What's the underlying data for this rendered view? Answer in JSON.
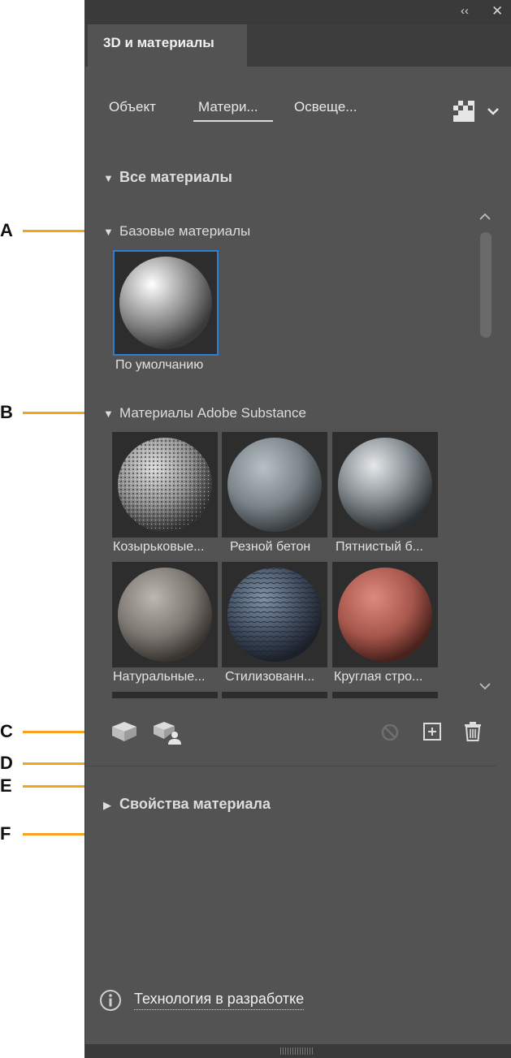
{
  "panel": {
    "tab_title": "3D и материалы",
    "subtabs": [
      "Объект",
      "Матери...",
      "Освеще..."
    ],
    "active_subtab": "Матери...",
    "all_materials": "Все материалы",
    "base_materials": "Базовые материалы",
    "substance_materials": "Материалы Adobe Substance",
    "material_properties": "Свойства материала",
    "footer_link": "Технология в разработке"
  },
  "base_tiles": [
    {
      "label": "По умолчанию"
    }
  ],
  "substance_tiles": [
    {
      "label": "Козырьковые..."
    },
    {
      "label": "Резной бетон"
    },
    {
      "label": "Пятнистый б..."
    },
    {
      "label": "Натуральные..."
    },
    {
      "label": "Стилизованн..."
    },
    {
      "label": "Круглая стро..."
    }
  ],
  "callouts": [
    "A",
    "B",
    "C",
    "D",
    "E",
    "F"
  ],
  "icons": {
    "collapse": "double-chevron-left-icon",
    "close": "close-icon",
    "options": "panel-options-icon",
    "add_material": "cube-icon",
    "add_graph": "cube-person-icon",
    "revert": "no-entry-icon",
    "new": "plus-square-icon",
    "delete": "trash-icon",
    "info": "info-icon"
  },
  "colors": {
    "panel": "#535353",
    "callout": "#f5a21f",
    "selection": "#2f7fd0"
  }
}
